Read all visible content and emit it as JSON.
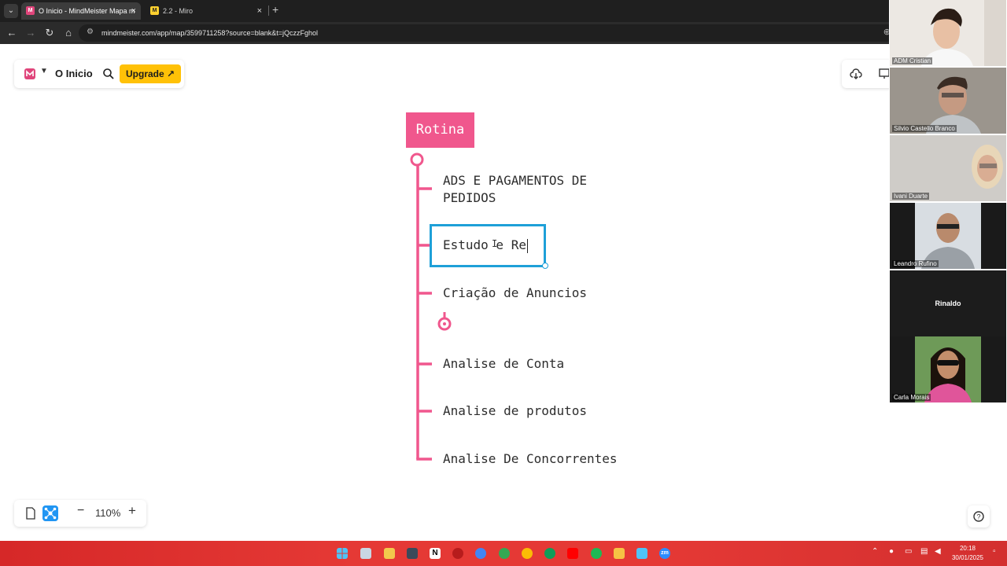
{
  "browser": {
    "tabs": [
      {
        "title": "O Inicio - MindMeister Mapa m",
        "favicon": "mindmeister-favicon",
        "active": true
      },
      {
        "title": "2.2 - Miro",
        "favicon": "miro-favicon",
        "active": false
      }
    ],
    "url": "mindmeister.com/app/map/3599711258?source=blank&t=jQczzFghol"
  },
  "app": {
    "map_title": "O Inicio",
    "upgrade_label": "Upgrade ↗",
    "zoom_level": "110%",
    "zoom_out_glyph": "−",
    "zoom_in_glyph": "+",
    "accent_color": "#f0578d",
    "selection_color": "#1ea0d8"
  },
  "mindmap": {
    "root": "Rotina",
    "children": [
      "ADS E PAGAMENTOS DE",
      "PEDIDOS",
      "Estudo e Re",
      "Criação de Anuncios",
      "Analise de Conta",
      "Analise de produtos",
      "Analise De Concorrentes"
    ],
    "editing_index": 2
  },
  "participants": [
    {
      "name": "ADM Cristian"
    },
    {
      "name": "Silvio Castello Branco"
    },
    {
      "name": "Ivani Duarte"
    },
    {
      "name": "Leandro Rufino"
    },
    {
      "name": "Rinaldo"
    },
    {
      "name": "Carla Morais"
    }
  ],
  "taskbar": {
    "time": "20:18",
    "date": "30/01/2025",
    "zoom_app_label": "zm"
  }
}
